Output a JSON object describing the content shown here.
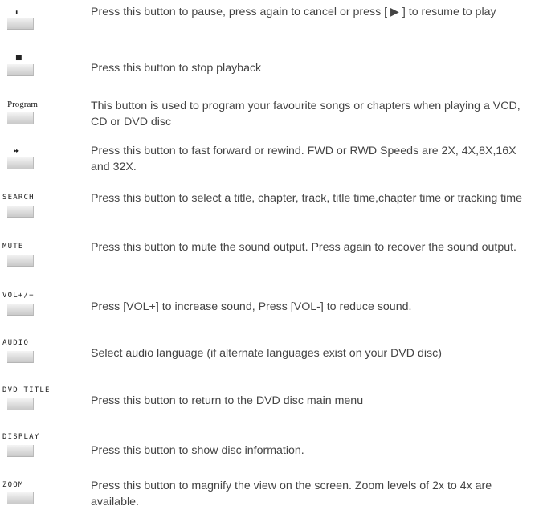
{
  "rows": [
    {
      "symbol": "⏸",
      "label": "",
      "text": "Press this button to pause, press again to cancel or press [ ▶ ] to resume to play"
    },
    {
      "symbol": "■",
      "label": "",
      "text": "Press this button to stop playback"
    },
    {
      "symbol": "",
      "label": "Program",
      "text": "This button is used to program your favourite songs or chapters when playing a VCD, CD or DVD disc"
    },
    {
      "symbol": "▸▸",
      "label": "",
      "text": "Press this button to fast forward or rewind. FWD or RWD Speeds are 2X, 4X,8X,16X and 32X."
    },
    {
      "symbol": "",
      "label": "SEARCH",
      "text": "Press this button to select a title, chapter, track, title time,chapter time or tracking time"
    },
    {
      "symbol": "",
      "label": "MUTE",
      "text": "Press this button to mute the sound output. Press again to recover the sound output."
    },
    {
      "symbol": "",
      "label": "VOL+/−",
      "text": "Press [VOL+] to increase sound, Press [VOL-] to reduce sound."
    },
    {
      "symbol": "",
      "label": "AUDIO",
      "text": "Select audio language (if alternate languages exist on your DVD disc)"
    },
    {
      "symbol": "",
      "label": "DVD TITLE",
      "text": "Press this button to return to the DVD disc main menu"
    },
    {
      "symbol": "",
      "label": "DISPLAY",
      "text": "Press this button to show disc information."
    },
    {
      "symbol": "",
      "label": "ZOOM",
      "text": "Press this button to magnify the view on the screen. Zoom levels of 2x to 4x are available."
    }
  ]
}
